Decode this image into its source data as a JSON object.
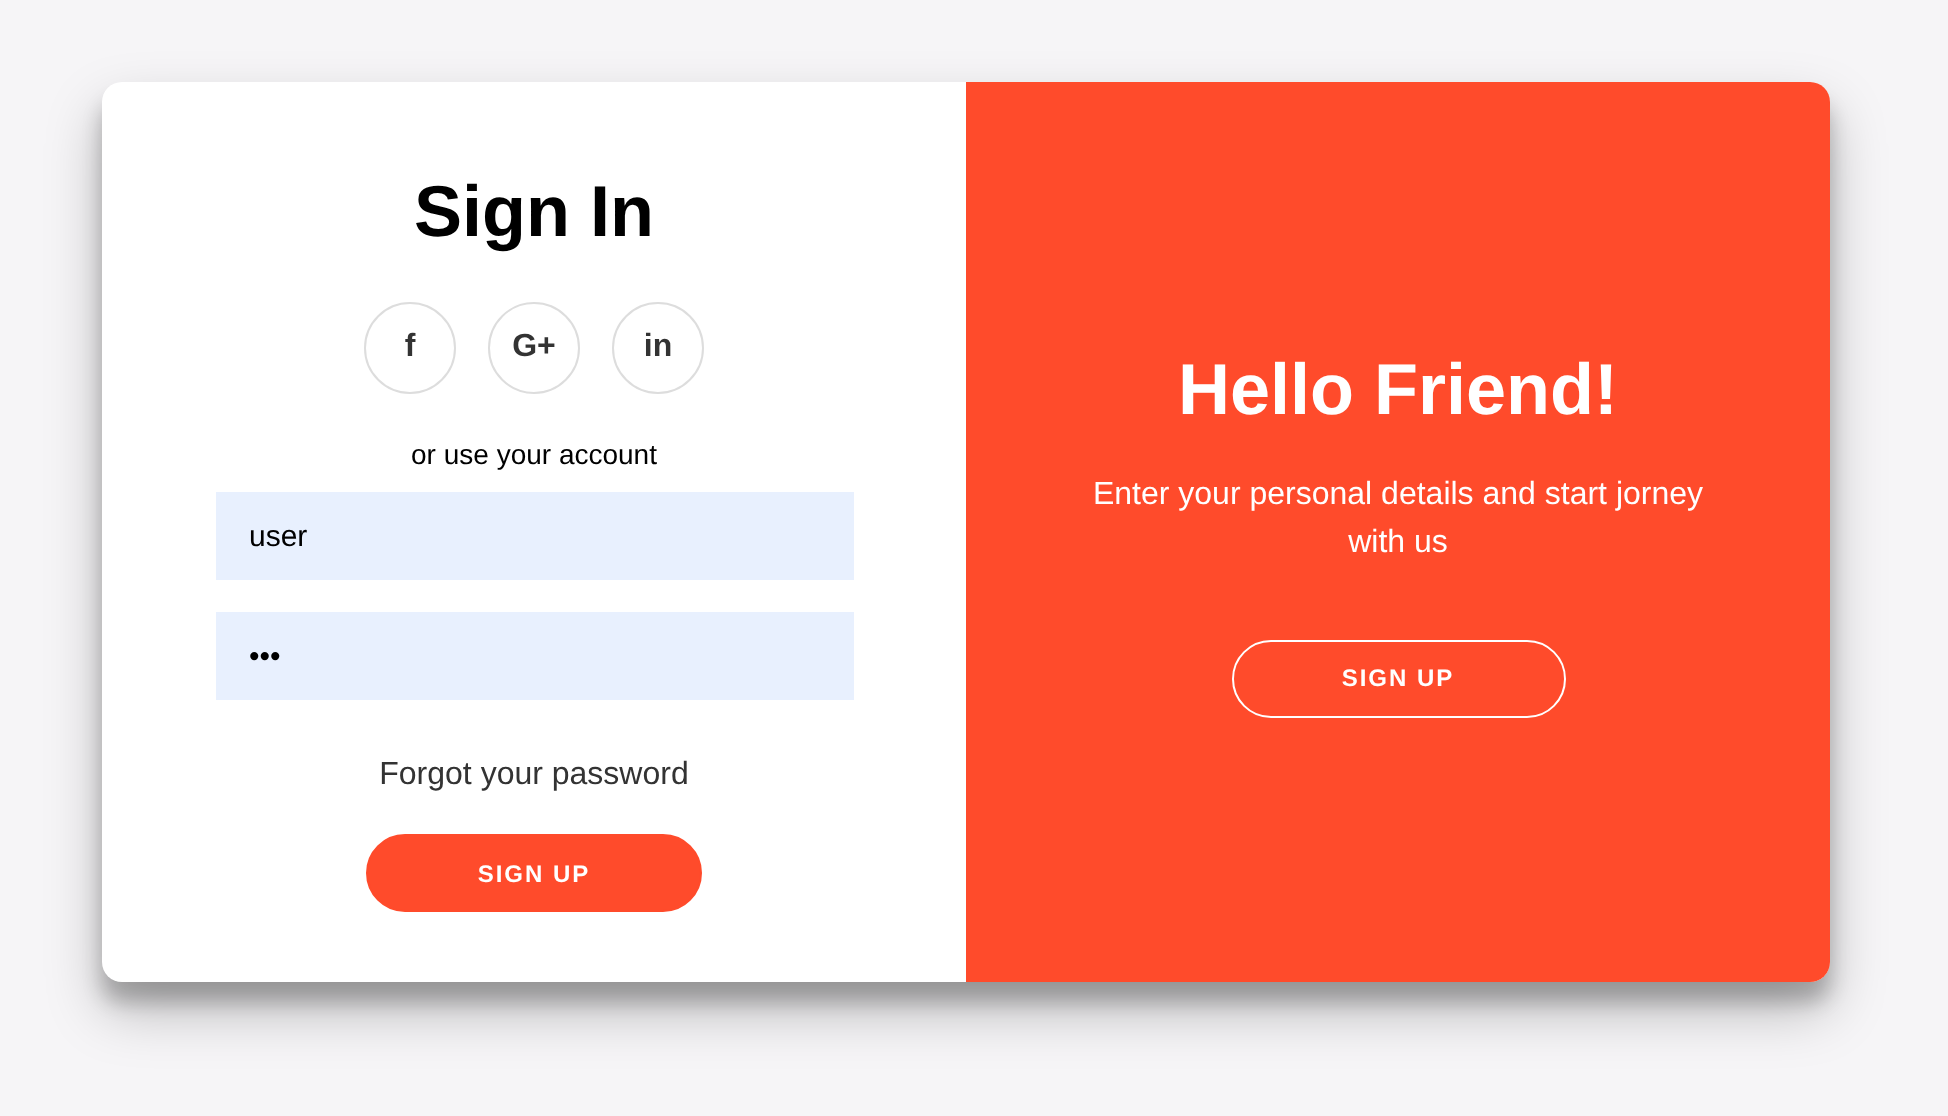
{
  "sign_in": {
    "title": "Sign In",
    "social": [
      {
        "label": "f"
      },
      {
        "label": "G+"
      },
      {
        "label": "in"
      }
    ],
    "hint": "or use your account",
    "fields": [
      {
        "value": "user"
      },
      {
        "value": "•••"
      }
    ],
    "forgot": "Forgot your password",
    "button": "SIGN UP"
  },
  "overlay": {
    "title": "Hello Friend!",
    "text": "Enter your personal details and start jorney with us",
    "button": "SIGN UP"
  }
}
